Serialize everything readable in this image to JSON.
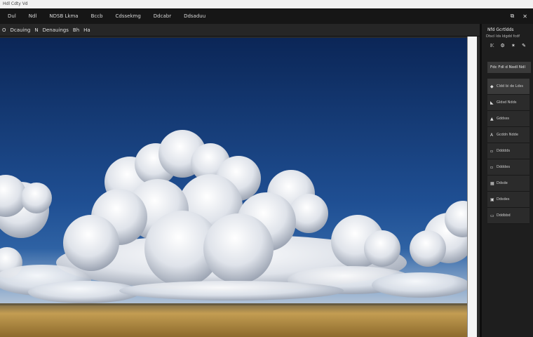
{
  "window": {
    "title": "Hdl Cdty Vd"
  },
  "menubar": {
    "items": [
      "Dul",
      "Ndl",
      "NDSB Lkma",
      "Bccb",
      "Cdssekmg",
      "Ddcabr",
      "Ddsaduu"
    ],
    "right_icons": [
      "square-icon",
      "close-icon"
    ],
    "right_glyphs": [
      "⧉",
      "✕"
    ]
  },
  "options": {
    "items": [
      "O",
      "Dcauing",
      "N",
      "Denauings",
      "Bh",
      "Ha"
    ]
  },
  "panel": {
    "title": "Nfd Gcrtldds",
    "subtitle": "Dtscl lds ldgdd fcdf",
    "icons": [
      "𝕂",
      "⚙",
      "✶",
      "✎"
    ],
    "button_label": "Fdc Fdl d Nodl Ndl",
    "layers": [
      {
        "icon": "◆",
        "label": "Cldd bi de Ldss"
      },
      {
        "icon": "◣",
        "label": "Gldsd Ndds"
      },
      {
        "icon": "▲",
        "label": "Gddsss"
      },
      {
        "icon": "A",
        "label": "Gcddn Ndde"
      },
      {
        "icon": "▫",
        "label": "Ddddds"
      },
      {
        "icon": "▫",
        "label": "Ddddes"
      },
      {
        "icon": "▦",
        "label": "Ddsde"
      },
      {
        "icon": "▣",
        "label": "Ddsdes"
      },
      {
        "icon": "▭",
        "label": "Dddbbd"
      }
    ]
  },
  "colors": {
    "sky_top": "#0c2a5e",
    "sky_bottom": "#3c74b8",
    "field": "#b08b45",
    "panel_bg": "#1e1e1e"
  }
}
